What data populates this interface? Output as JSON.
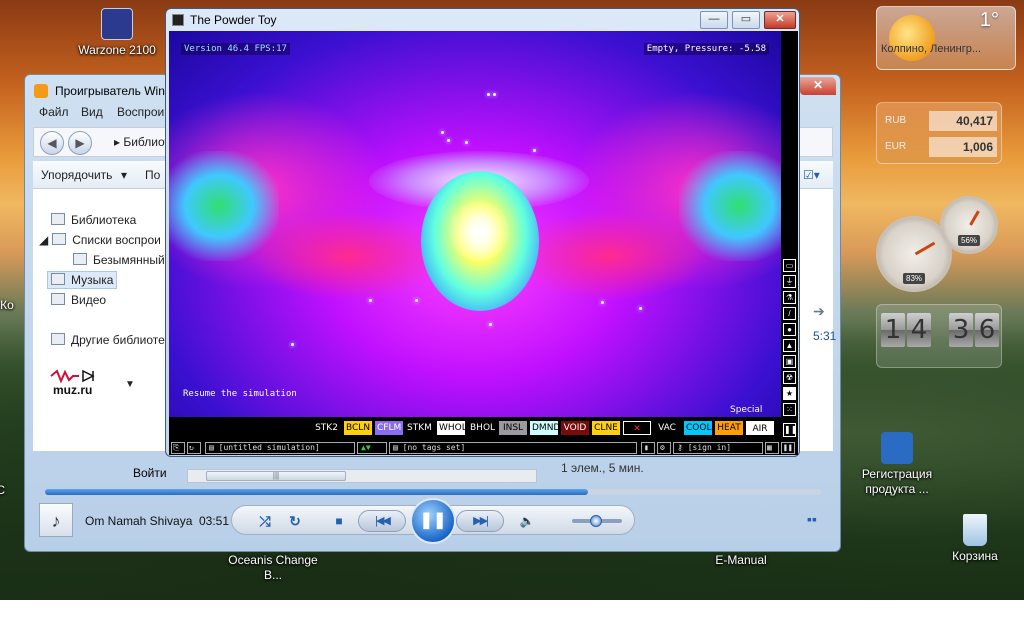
{
  "desktop": {
    "icons": [
      {
        "label": "Warzone 2100",
        "color": "#2b3a8c"
      },
      {
        "label": "Регистрация продукта ...",
        "color": "#2a6bc4"
      },
      {
        "label": "Корзина",
        "color": "#bcd6ec"
      },
      {
        "label": "Oceanis Change B...",
        "color": "#3a6a3a"
      },
      {
        "label": "E-Manual",
        "color": "#2a6bc4"
      }
    ],
    "partial_left_1": "Ко",
    "partial_left_2": "С\nП"
  },
  "gadgets": {
    "weather": {
      "temp": "1°",
      "city": "Колпино, Ленингр..."
    },
    "currency": [
      {
        "code": "RUB",
        "value": "40,417"
      },
      {
        "code": "EUR",
        "value": "1,006"
      }
    ],
    "meters": {
      "cpu": "83%",
      "mem": "56%"
    },
    "clock": {
      "h1": "1",
      "h2": "4",
      "m1": "3",
      "m2": "6"
    }
  },
  "wmp": {
    "title": "Проигрыватель Win",
    "menu": [
      "Файл",
      "Вид",
      "Воспрои"
    ],
    "breadcrumb": "▸ Библиот",
    "toolbar": {
      "organize": "Упорядочить",
      "other": "По"
    },
    "tree": [
      {
        "label": "Библиотека"
      },
      {
        "label": "Списки воспрои"
      },
      {
        "label": "Безымянный"
      },
      {
        "label": "Музыка"
      },
      {
        "label": "Видео"
      },
      {
        "label": "Другие библиоте"
      }
    ],
    "muzru": "muz.ru",
    "right_time": "5:31",
    "status": "1 элем., 5 мин.",
    "login": "Войти",
    "scroll_grip": "|||",
    "track": "Om Namah Shivaya",
    "time": "03:51",
    "progress": 0.7
  },
  "powdertoy": {
    "title": "The Powder Toy",
    "version": "Version 46.4 FPS:17",
    "info": "Empty, Pressure: -5.58",
    "hint": "Resume the simulation",
    "category_label": "Special",
    "elements": [
      {
        "name": "STK2",
        "bg": "#000000",
        "fg": "#ffffff"
      },
      {
        "name": "BCLN",
        "bg": "#ffd010",
        "fg": "#000000"
      },
      {
        "name": "CFLM",
        "bg": "#8a6cf0",
        "fg": "#ffffff"
      },
      {
        "name": "STKM",
        "bg": "#000000",
        "fg": "#ffffff"
      },
      {
        "name": "WHOL",
        "bg": "#ffffff",
        "fg": "#000000"
      },
      {
        "name": "BHOL",
        "bg": "#000000",
        "fg": "#ffffff"
      },
      {
        "name": "INSL",
        "bg": "#9a9aa0",
        "fg": "#000000"
      },
      {
        "name": "DMND",
        "bg": "#ccffff",
        "fg": "#000000"
      },
      {
        "name": "VOID",
        "bg": "#790b0b",
        "fg": "#ffffff"
      },
      {
        "name": "CLNE",
        "bg": "#ffd010",
        "fg": "#000000"
      },
      {
        "name": "✕",
        "bg": "#000000",
        "fg": "#ff3030"
      },
      {
        "name": "VAC",
        "bg": "#000000",
        "fg": "#ffffff"
      },
      {
        "name": "COOL",
        "bg": "#00c8ff",
        "fg": "#000000"
      },
      {
        "name": "HEAT",
        "bg": "#ffa000",
        "fg": "#000000"
      },
      {
        "name": "AIR",
        "bg": "#ffffff",
        "fg": "#000000"
      }
    ],
    "categories": [
      "▭",
      "⏚",
      "⚗",
      "/",
      "●",
      "▲",
      "▣",
      "☢",
      "★",
      "⁙"
    ],
    "bottom": {
      "sim_name": "[untitled simulation]",
      "tags": "[no tags set]",
      "sign_in": "[sign in]"
    }
  }
}
